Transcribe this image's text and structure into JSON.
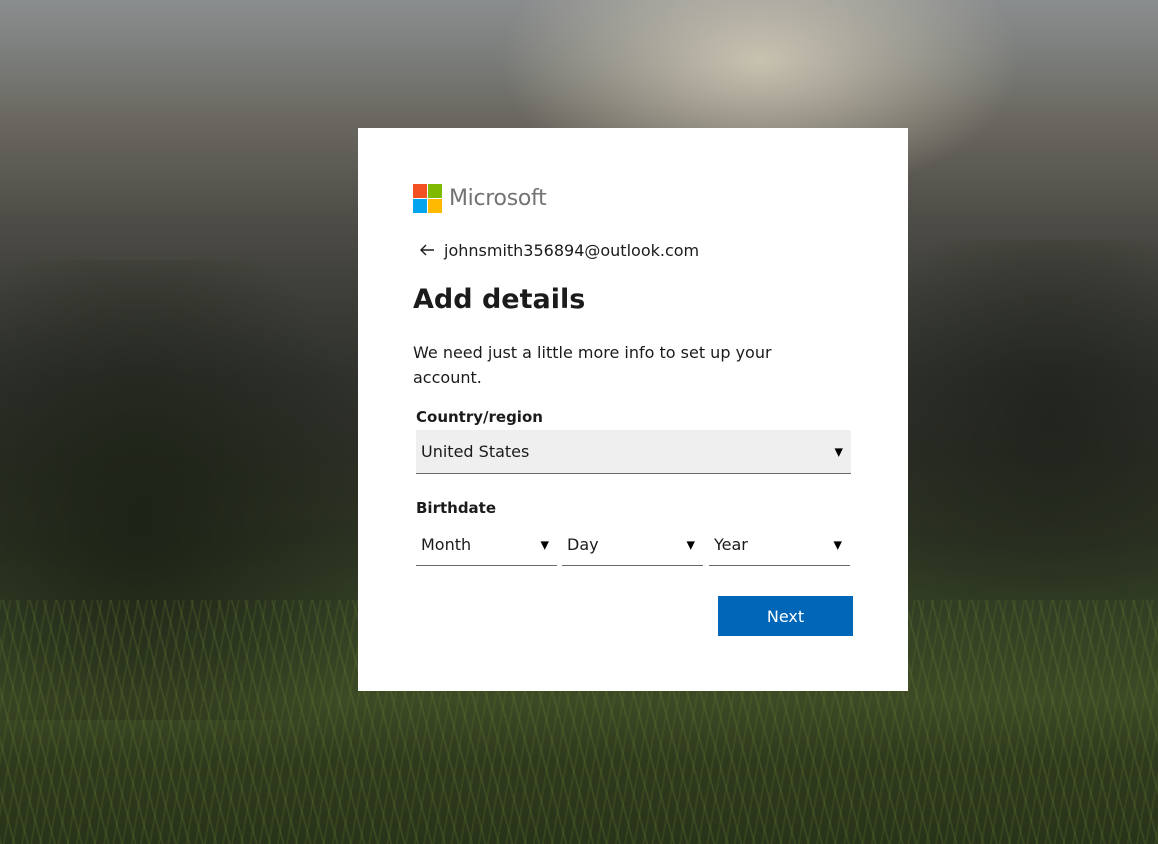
{
  "brand": {
    "name": "Microsoft",
    "logo_colors": {
      "red": "#f25022",
      "green": "#7fba00",
      "blue": "#00a4ef",
      "yellow": "#ffb900"
    }
  },
  "identity": {
    "back_icon": "arrow-left-icon",
    "email": "johnsmith356894@outlook.com"
  },
  "form": {
    "title": "Add details",
    "description": "We need just a little more info to set up your account.",
    "country": {
      "label": "Country/region",
      "value": "United States"
    },
    "birthdate": {
      "label": "Birthdate",
      "month": "Month",
      "day": "Day",
      "year": "Year"
    },
    "next_label": "Next",
    "accent_color": "#0067b8"
  }
}
